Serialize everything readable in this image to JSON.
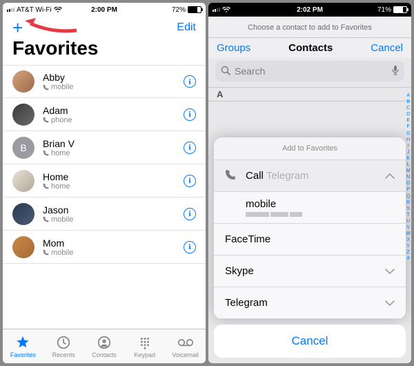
{
  "left": {
    "status": {
      "carrier": "AT&T Wi-Fi",
      "time": "2:00 PM",
      "battery_pct": "72%",
      "battery_fill": 72
    },
    "nav": {
      "add": "+",
      "edit": "Edit"
    },
    "title": "Favorites",
    "contacts": [
      {
        "name": "Abby",
        "type": "mobile",
        "avatar_bg": "linear-gradient(135deg,#d8a27a,#9a6b4e)",
        "initial": ""
      },
      {
        "name": "Adam",
        "type": "phone",
        "avatar_bg": "linear-gradient(135deg,#3a3a3a,#6a6a6a)",
        "initial": ""
      },
      {
        "name": "Brian V",
        "type": "home",
        "avatar_bg": "#9a9aa0",
        "initial": "B"
      },
      {
        "name": "Home",
        "type": "home",
        "avatar_bg": "linear-gradient(135deg,#e8e2d8,#b0a896)",
        "initial": ""
      },
      {
        "name": "Jason",
        "type": "mobile",
        "avatar_bg": "linear-gradient(135deg,#2a3a52,#4a5a72)",
        "initial": ""
      },
      {
        "name": "Mom",
        "type": "mobile",
        "avatar_bg": "linear-gradient(135deg,#c98a4a,#a56832)",
        "initial": ""
      }
    ],
    "tabs": [
      {
        "label": "Favorites"
      },
      {
        "label": "Recents"
      },
      {
        "label": "Contacts"
      },
      {
        "label": "Keypad"
      },
      {
        "label": "Voicemail"
      }
    ]
  },
  "right": {
    "status": {
      "time": "2:02 PM",
      "battery_pct": "71%",
      "battery_fill": 71
    },
    "picker_title": "Choose a contact to add to Favorites",
    "nav": {
      "groups": "Groups",
      "title": "Contacts",
      "cancel": "Cancel"
    },
    "search_placeholder": "Search",
    "section": "A",
    "sheet": {
      "title": "Add to Favorites",
      "rows": [
        {
          "label": "Call",
          "sub": "Telegram",
          "expanded": true,
          "icon": "phone"
        },
        {
          "label": "mobile",
          "indent": true
        },
        {
          "label": "FaceTime"
        },
        {
          "label": "Skype",
          "chev": true
        },
        {
          "label": "Telegram",
          "chev": true
        }
      ],
      "cancel": "Cancel"
    }
  }
}
